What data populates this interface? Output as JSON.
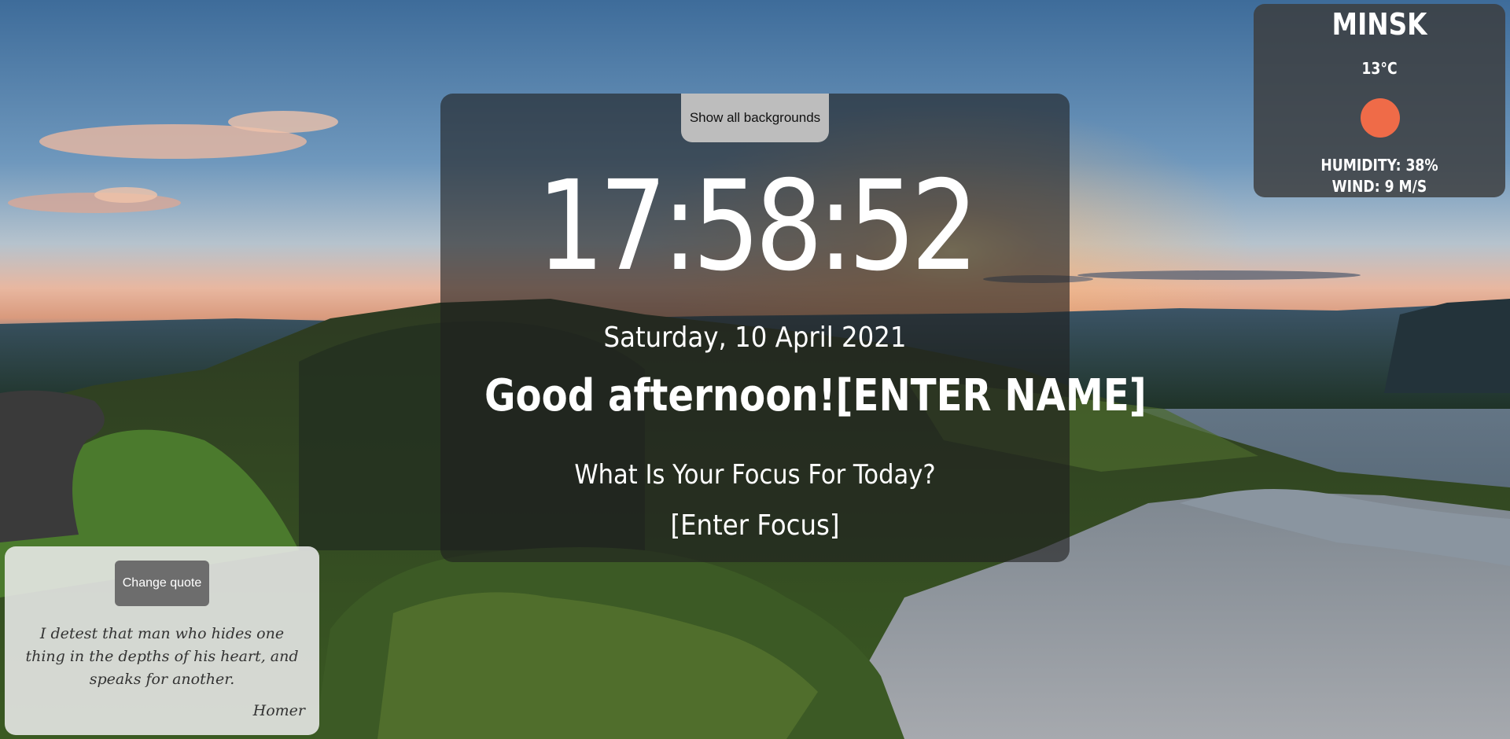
{
  "header": {
    "show_backgrounds_label": "Show all backgrounds"
  },
  "clock": {
    "time": "17:58:52",
    "date": "Saturday, 10 April 2021"
  },
  "greeting": {
    "text": "Good afternoon!",
    "name": "[ENTER NAME]"
  },
  "focus": {
    "question": "What Is Your Focus For Today?",
    "value": "[Enter Focus]"
  },
  "weather": {
    "city": "MINSK",
    "temperature": "13°C",
    "icon": "sun-icon",
    "icon_color": "#ef6b48",
    "humidity": "HUMIDITY: 38%",
    "wind": "WIND: 9 M/S"
  },
  "quote": {
    "change_label": "Change quote",
    "text": "I detest that man who hides one thing in the depths of his heart, and speaks for another.",
    "author": "Homer"
  },
  "colors": {
    "panel_bg": "rgba(30,30,30,0.62)",
    "button_bg": "#bdbdbd",
    "quote_button_bg": "#6d6d6d"
  }
}
